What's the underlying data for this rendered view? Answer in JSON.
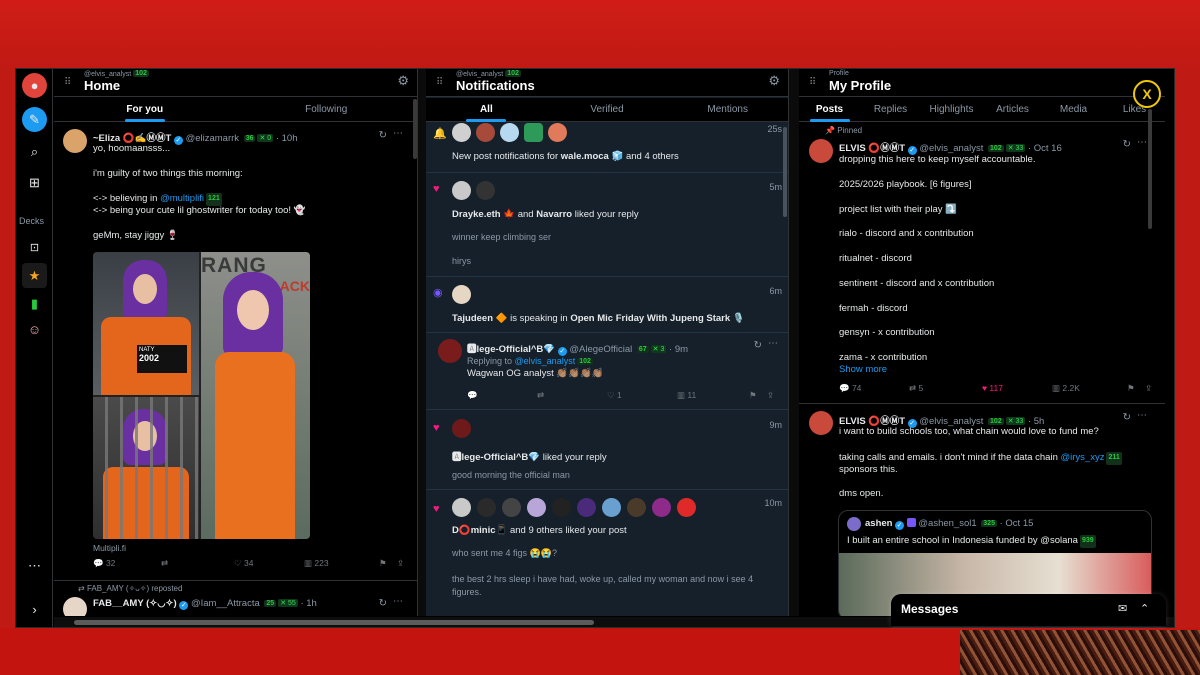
{
  "rail": {
    "decks_label": "Decks"
  },
  "col1": {
    "subtitle": "@elvis_analyst",
    "sub_badge": "102",
    "title": "Home",
    "tabs": [
      "For you",
      "Following"
    ],
    "tweet1": {
      "name": "~Eliza ⭕✍️ⓂⓂT",
      "handle": "@elizamarrk",
      "badge1": "36",
      "badge2": "✕ 0",
      "time": "10h",
      "l1": "yo, hoomaansss...",
      "l2": "i'm guilty of two things this morning:",
      "l3a": "<-> believing in ",
      "l3b": "@multiplifi",
      "l3c": "121",
      "l4": "<-> being your cute lil ghostwriter for today too! 👻",
      "l5": "geMm, stay jiggy 🍷",
      "sign": "NATY",
      "sign2": "2002",
      "wall": "RANG",
      "wall2": "BLACK",
      "source": "Multipli.fi",
      "replies": "32",
      "likes": "34",
      "views": "223"
    },
    "repost_label": "FAB_AMY (✧ᴗ✧) reposted",
    "tweet2": {
      "name": "FAB__AMY (✧◡✧)",
      "handle": "@Iam__Attracta",
      "badge1": "25",
      "badge2": "✕ 55",
      "time": "1h"
    }
  },
  "col2": {
    "subtitle": "@elvis_analyst",
    "sub_badge": "102",
    "title": "Notifications",
    "tabs": [
      "All",
      "Verified",
      "Mentions"
    ],
    "n1": {
      "time": "25s",
      "pre": "New post notifications for ",
      "bold": "wale.moca 🧊",
      "post": " and 4 others"
    },
    "n2": {
      "time": "5m",
      "a": "Drayke.eth 🍁",
      "and": " and ",
      "b": "Navarro",
      "post": " liked your reply",
      "q1": "winner keep climbing ser",
      "q2": "hirys"
    },
    "n3": {
      "time": "6m",
      "a": "Tajudeen 🔶",
      "mid": " is speaking in ",
      "b": "Open Mic Friday With Jupeng Stark 🎙️"
    },
    "reply": {
      "name": "🅰lege-Official^B💎",
      "handle": "@AlegeOfficial",
      "badge1": "67",
      "badge2": "✕ 3",
      "time": "9m",
      "replying": "Replying to ",
      "rh": "@elvis_analyst",
      "rb": "102",
      "text": "Wagwan OG analyst 👏🏽👏🏽👏🏽👏🏽",
      "likes": "1",
      "views": "11"
    },
    "n4": {
      "time": "9m",
      "a": "🅰lege-Official^B💎",
      "post": " liked your reply",
      "q": "good morning the official man"
    },
    "n5": {
      "time": "10m",
      "a": "D⭕minic📱",
      "post": " and 9 others liked your post",
      "q1": "who sent me 4 figs 😭😭?",
      "q2": "the best 2 hrs sleep i have had, woke up, called my woman and now i see 4 figures."
    }
  },
  "col3": {
    "subtitle": "Profile",
    "title": "My Profile",
    "tabs": [
      "Posts",
      "Replies",
      "Highlights",
      "Articles",
      "Media",
      "Likes"
    ],
    "pinned": "Pinned",
    "p1": {
      "name": "ELVIS ⭕ⓂⓂT",
      "handle": "@elvis_analyst",
      "badge1": "102",
      "badge2": "✕ 33",
      "time": "Oct 16",
      "lines": [
        "dropping this here to keep myself accountable.",
        "2025/2026 playbook. [6 figures]",
        "project list with their play ⤵️",
        "rialo - discord and x contribution",
        "ritualnet - discord",
        "sentinent - discord and x contribution",
        "fermah - discord",
        "gensyn - x contribution",
        "zama - x contribution"
      ],
      "more": "Show more",
      "replies": "74",
      "reposts": "5",
      "likes": "117",
      "views": "2.2K"
    },
    "p2": {
      "name": "ELVIS ⭕ⓂⓂT",
      "handle": "@elvis_analyst",
      "badge1": "102",
      "badge2": "✕ 33",
      "time": "5h",
      "l1": "i want to build schools too, what chain would love to fund me?",
      "l2a": "taking calls and emails. i don't mind if the data chain ",
      "l2b": "@irys_xyz",
      "l2c": "211",
      "l3": "sponsors this.",
      "l4": "dms open.",
      "q": {
        "name": "ashen",
        "handle": "@ashen_sol1",
        "badge": "325",
        "time": "Oct 15",
        "text": "I built an entire school in Indonesia funded by @solana",
        "tb": "939"
      }
    }
  },
  "messages": {
    "label": "Messages"
  }
}
